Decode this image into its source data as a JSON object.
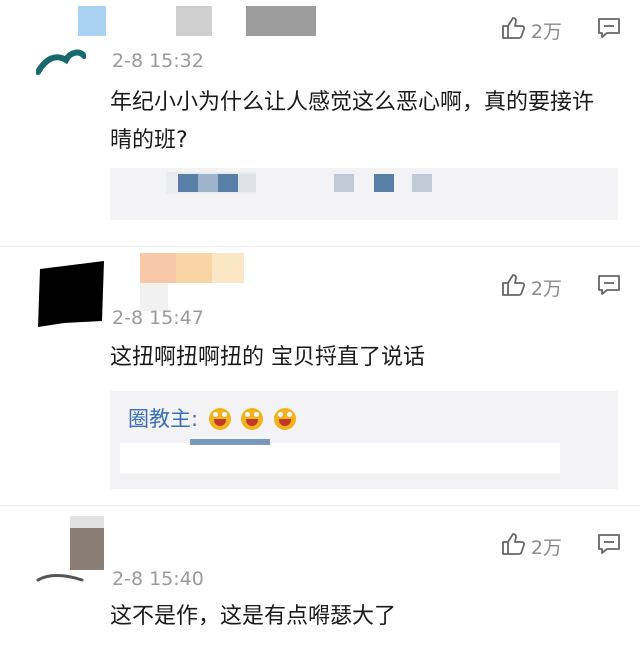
{
  "comments": [
    {
      "time": "2-8 15:32",
      "text": "年纪小小为什么让人感觉这么恶心啊，真的要接许晴的班?",
      "likes": "2万"
    },
    {
      "time": "2-8 15:47",
      "text": "这扭啊扭啊扭的 宝贝捋直了说话",
      "likes": "2万",
      "reply": {
        "author": "圈教主:",
        "emoji_count": 3
      }
    },
    {
      "time": "2-8 15:40",
      "text": "这不是作，这是有点嘚瑟大了",
      "likes": "2万"
    }
  ],
  "icons": {
    "like": "thumbs-up-icon",
    "reply": "comment-icon"
  },
  "colors": {
    "reply_author": "#3a6fb4",
    "meta_gray": "#9a9a9a"
  }
}
